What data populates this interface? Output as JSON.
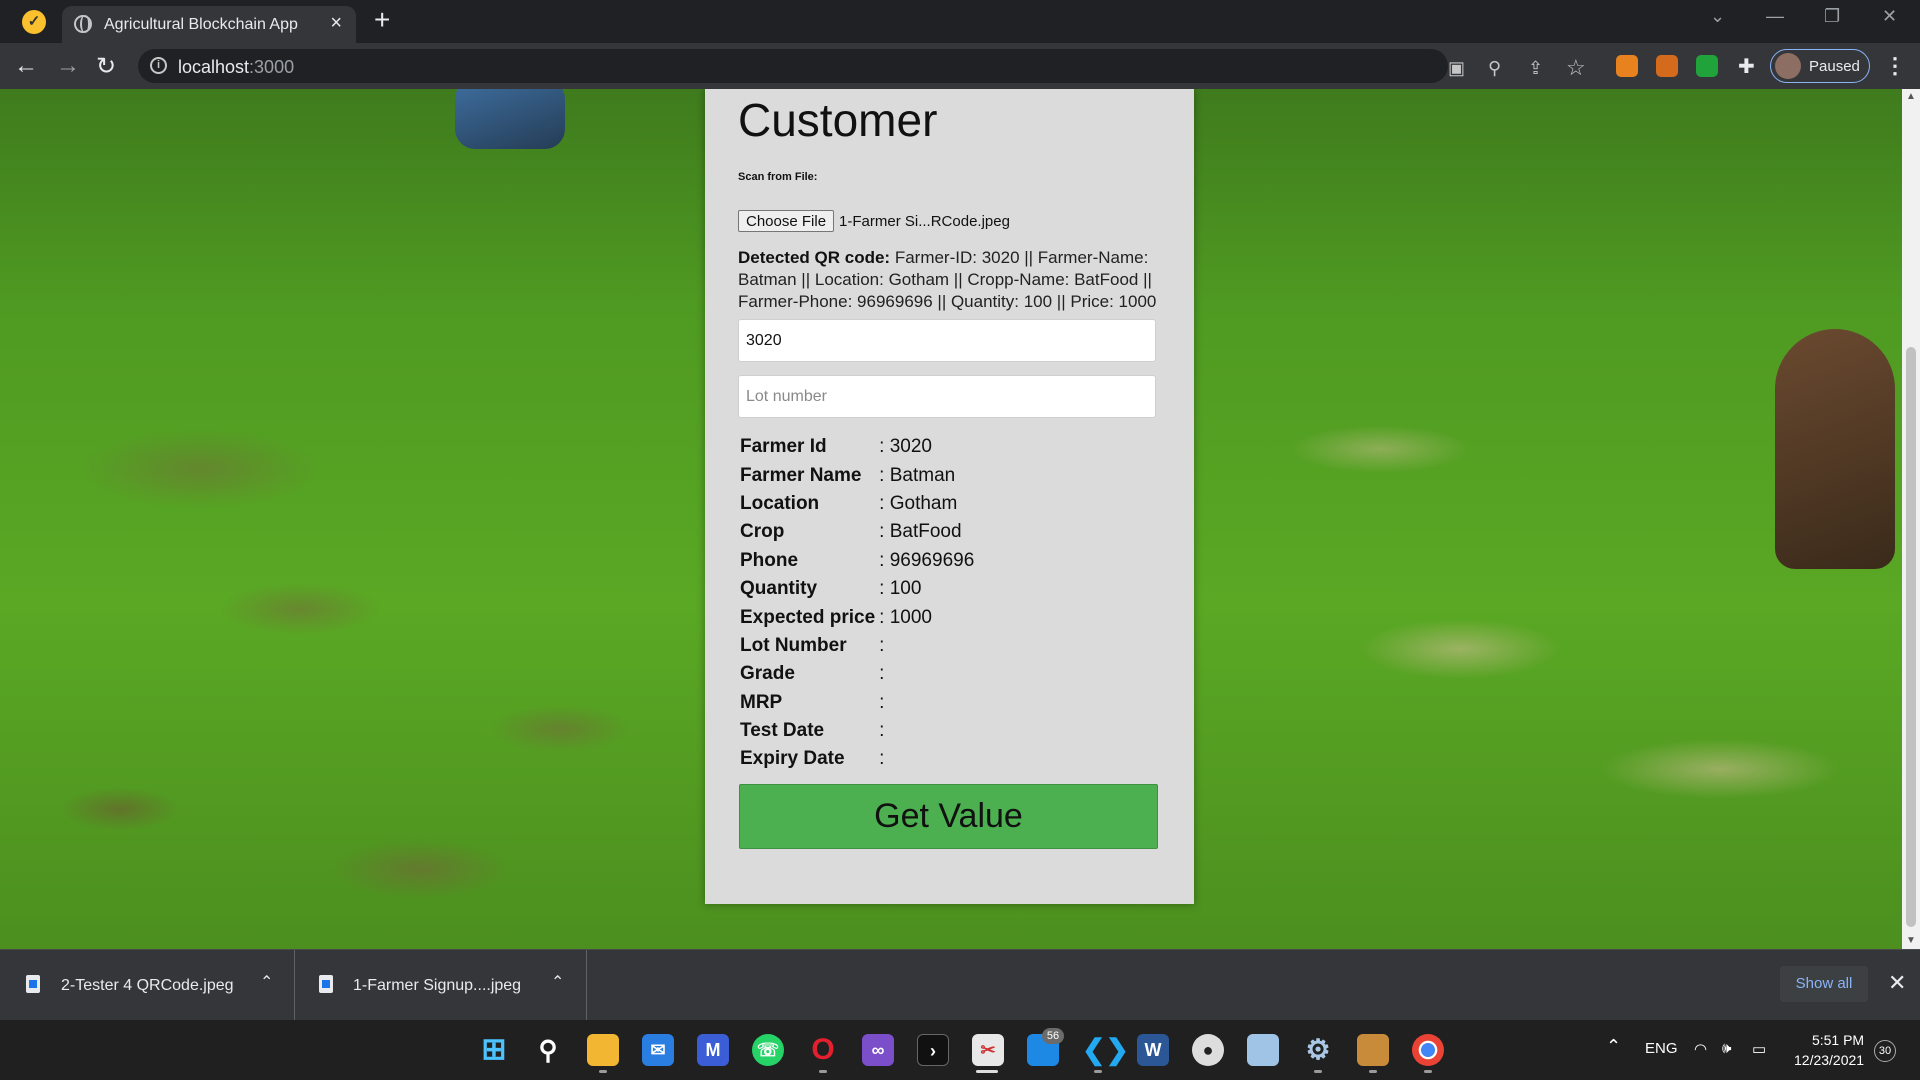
{
  "browser": {
    "tab_title": "Agricultural Blockchain App",
    "url_host": "localhost",
    "url_port": ":3000",
    "profile_label": "Paused"
  },
  "page": {
    "heading": "Customer",
    "scan_label": "Scan from File:",
    "choose_file_label": "Choose File",
    "chosen_file_name": "1-Farmer Si...RCode.jpeg",
    "qr_label": "Detected QR code:",
    "qr_value": " Farmer-ID: 3020 || Farmer-Name: Batman || Location: Gotham || Cropp-Name: BatFood || Farmer-Phone: 96969696 || Quantity: 100 || Price: 1000",
    "farmer_id_input_value": "3020",
    "lot_number_placeholder": "Lot number",
    "details": [
      {
        "label": "Farmer Id",
        "value": ": 3020"
      },
      {
        "label": "Farmer Name",
        "value": ": Batman"
      },
      {
        "label": "Location",
        "value": ": Gotham"
      },
      {
        "label": "Crop",
        "value": ": BatFood"
      },
      {
        "label": "Phone",
        "value": ": 96969696"
      },
      {
        "label": "Quantity",
        "value": ": 100"
      },
      {
        "label": "Expected price",
        "value": ": 1000"
      },
      {
        "label": "Lot Number",
        "value": ":"
      },
      {
        "label": "Grade",
        "value": ":"
      },
      {
        "label": "MRP",
        "value": ":"
      },
      {
        "label": "Test Date",
        "value": ":"
      },
      {
        "label": "Expiry Date",
        "value": ":"
      }
    ],
    "get_value_label": "Get Value",
    "colors": {
      "button": "#4caf50",
      "card": "#dcdbdb"
    }
  },
  "downloads": {
    "items": [
      {
        "name": "2-Tester 4 QRCode.jpeg"
      },
      {
        "name": "1-Farmer Signup....jpeg"
      }
    ],
    "show_all_label": "Show all"
  },
  "taskbar": {
    "apps": [
      "start-icon",
      "search-icon",
      "file-explorer-icon",
      "mail-icon",
      "app-icon",
      "whatsapp-icon",
      "opera-icon",
      "visual-studio-icon",
      "terminal-icon",
      "snipping-tool-icon",
      "phone-link-icon",
      "vscode-icon",
      "word-icon",
      "github-icon",
      "photos-icon",
      "settings-icon",
      "package-icon",
      "chrome-icon"
    ],
    "badge_count": "56",
    "language": "ENG",
    "time": "5:51 PM",
    "date": "12/23/2021",
    "notification_count": "30"
  }
}
